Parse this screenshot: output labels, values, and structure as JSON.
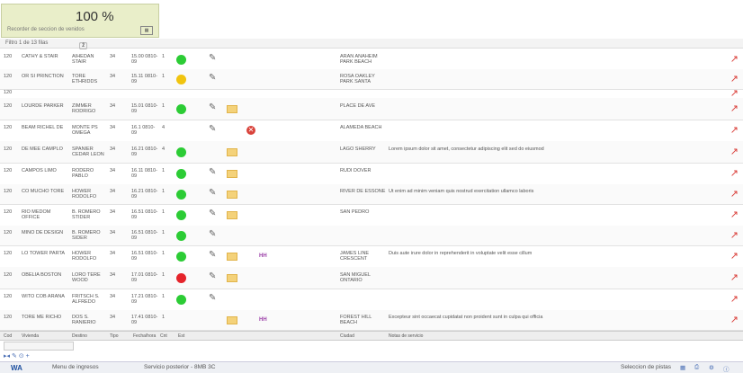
{
  "zoom": {
    "value": "100 %",
    "caption": "Recorder de seccion de venidos",
    "icon": "table-icon"
  },
  "toolbar": {
    "caption": "Filtro 1 de 13 filas",
    "page1": "1",
    "page2": "2"
  },
  "rows": [
    {
      "id": "120",
      "name": "CATHY & STAIR",
      "dest": "AIHEDAN STAIR",
      "typ": "34",
      "date": "15.00 0810-09",
      "cnt": "1",
      "status": "green",
      "pen": true,
      "folder": false,
      "xmark": false,
      "purple": "",
      "city": "ARAN ANAHEIM PARK BEACH",
      "notes": ""
    },
    {
      "id": "120",
      "name": "OR SI PRINCTION",
      "dest": "TORE ETHRIDDS",
      "typ": "34",
      "date": "15.11 0810-09",
      "cnt": "1",
      "status": "yellow",
      "pen": true,
      "folder": false,
      "xmark": false,
      "purple": "",
      "city": "ROSA OAKLEY PARK SANTA",
      "notes": ""
    },
    {
      "id": "120",
      "name": "",
      "dest": "",
      "typ": "",
      "date": "",
      "cnt": "",
      "status": "",
      "pen": false,
      "folder": false,
      "xmark": false,
      "purple": "",
      "city": "",
      "notes": ""
    },
    {
      "id": "120",
      "name": "LOURDE PARKER",
      "dest": "ZIMMER RODRIGO",
      "typ": "34",
      "date": "15.01 0810-09",
      "cnt": "1",
      "status": "green",
      "pen": true,
      "folder": true,
      "xmark": false,
      "purple": "",
      "city": "PLACE DE AVE",
      "notes": ""
    },
    {
      "id": "120",
      "name": "BEAM RICHEL DE",
      "dest": "MONTE PS OMEGA",
      "typ": "34",
      "date": "16.1 0810-09",
      "cnt": "4",
      "status": "",
      "pen": true,
      "folder": false,
      "xmark": true,
      "purple": "",
      "city": "ALAMEDA BEACH",
      "notes": ""
    },
    {
      "id": "120",
      "name": "DE MEE CAMPLO",
      "dest": "SPANIER CEDAR LEON",
      "typ": "34",
      "date": "16.21 0810-09",
      "cnt": "4",
      "status": "green",
      "pen": false,
      "folder": true,
      "xmark": false,
      "purple": "",
      "city": "LAGO SHERRY",
      "notes": "Lorem ipsum dolor sit amet, consectetur adipiscing elit sed do eiusmod"
    },
    {
      "id": "120",
      "name": "CAMPOS LIMO",
      "dest": "RODERO PABLO",
      "typ": "34",
      "date": "16.11 0810-09",
      "cnt": "1",
      "status": "green",
      "pen": true,
      "folder": true,
      "xmark": false,
      "purple": "",
      "city": "RUDI DOVER",
      "notes": ""
    },
    {
      "id": "120",
      "name": "CO MUCHO TORE",
      "dest": "HOWER RODOLFO",
      "typ": "34",
      "date": "16.21 0810-09",
      "cnt": "1",
      "status": "green",
      "pen": true,
      "folder": true,
      "xmark": false,
      "purple": "",
      "city": "RIVER DE ESSONE",
      "notes": "Ut enim ad minim veniam quis nostrud exercitation ullamco laboris"
    },
    {
      "id": "120",
      "name": "RIO MEDOM OFFICE",
      "dest": "B. ROMERO STIDER",
      "typ": "34",
      "date": "16.51 0810-09",
      "cnt": "1",
      "status": "green",
      "pen": true,
      "folder": true,
      "xmark": false,
      "purple": "",
      "city": "SAN PEDRO",
      "notes": ""
    },
    {
      "id": "120",
      "name": "MINO DE DESIGN",
      "dest": "B. ROMERO SIDER",
      "typ": "34",
      "date": "16.51 0810-09",
      "cnt": "1",
      "status": "green",
      "pen": true,
      "folder": false,
      "xmark": false,
      "purple": "",
      "city": "",
      "notes": ""
    },
    {
      "id": "120",
      "name": "LO TOWER PARTA",
      "dest": "HOWER RODOLFO",
      "typ": "34",
      "date": "16.51 0810-09",
      "cnt": "1",
      "status": "green",
      "pen": true,
      "folder": true,
      "xmark": false,
      "purple": "HH",
      "city": "JAMES LINE CRESCENT",
      "notes": "Duis aute irure dolor in reprehenderit in voluptate velit esse cillum"
    },
    {
      "id": "120",
      "name": "OBELIA BOSTON",
      "dest": "LORO TERE WOOD",
      "typ": "34",
      "date": "17.01 0810-09",
      "cnt": "1",
      "status": "red",
      "pen": true,
      "folder": true,
      "xmark": false,
      "purple": "",
      "city": "SAN MIGUEL ONTARIO",
      "notes": ""
    },
    {
      "id": "120",
      "name": "WITO COB ARANA",
      "dest": "FRITSCH S. ALFREDO",
      "typ": "34",
      "date": "17.21 0810-09",
      "cnt": "1",
      "status": "green",
      "pen": true,
      "folder": false,
      "xmark": false,
      "purple": "",
      "city": "",
      "notes": ""
    },
    {
      "id": "120",
      "name": "TORE ME RICHO",
      "dest": "DOS S. RANIERIO",
      "typ": "34",
      "date": "17.41 0810-09",
      "cnt": "1",
      "status": "",
      "pen": false,
      "folder": true,
      "xmark": false,
      "purple": "HH",
      "city": "FOREST HILL BEACH",
      "notes": "Excepteur sint occaecat cupidatat non proident sunt in culpa qui officia"
    }
  ],
  "header": {
    "id": "Cod",
    "name": "Vivienda",
    "dest": "Destino",
    "typ": "Tipo",
    "date": "Fecha/hora",
    "cnt": "Cnt",
    "st": "Est",
    "city": "Ciudad",
    "notes": "Notas de servicio"
  },
  "footer": {
    "nav": "▸◂ ✎ ⊙ +"
  },
  "status": {
    "logo": "WA",
    "left": "Menu de ingresos",
    "mid": "Servicio posterior - 8MB 3C",
    "right": "Seleccion de pistas"
  }
}
